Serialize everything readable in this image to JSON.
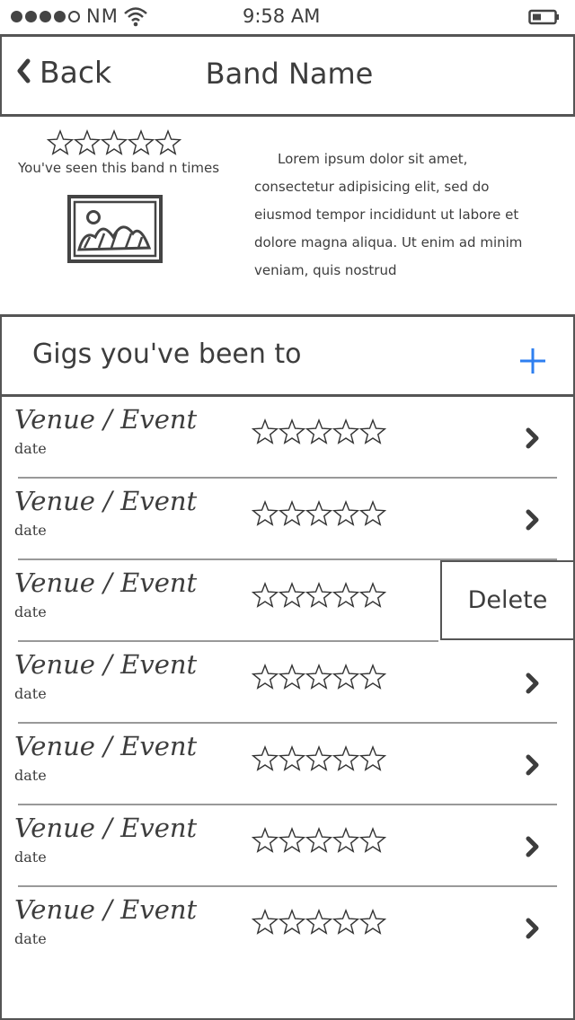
{
  "status_bar": {
    "carrier": "NM",
    "time": "9:58 AM"
  },
  "nav": {
    "back_label": "Back",
    "title": "Band Name"
  },
  "band": {
    "rating": 0,
    "seen_text": "You've seen this band n times",
    "description": "Lorem ipsum dolor sit amet, consectetur adipisicing elit, sed do eiusmod tempor incididunt ut labore et dolore magna aliqua. Ut enim ad minim veniam, quis nostrud"
  },
  "section": {
    "title": "Gigs you've been to",
    "add_icon": "plus-icon"
  },
  "colors": {
    "accent": "#2e7ff0",
    "ink": "#3d3d3d"
  },
  "gigs": [
    {
      "venue": "Venue / Event",
      "date": "date",
      "rating": 0
    },
    {
      "venue": "Venue / Event",
      "date": "date",
      "rating": 0
    },
    {
      "venue": "Venue / Event",
      "date": "date",
      "rating": 0,
      "delete_label": "Delete"
    },
    {
      "venue": "Venue / Event",
      "date": "date",
      "rating": 0
    },
    {
      "venue": "Venue / Event",
      "date": "date",
      "rating": 0
    },
    {
      "venue": "Venue / Event",
      "date": "date",
      "rating": 0
    },
    {
      "venue": "Venue / Event",
      "date": "date",
      "rating": 0
    }
  ]
}
